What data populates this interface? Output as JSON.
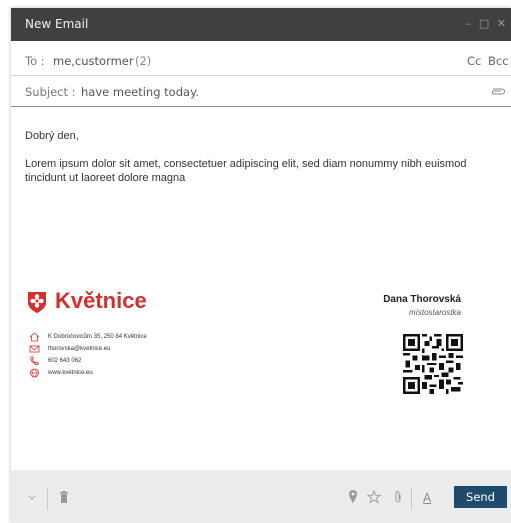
{
  "window": {
    "title": "New Email"
  },
  "to": {
    "label": "To :",
    "value": "me,custormer",
    "count": "(2)",
    "cc_label": "Cc",
    "bcc_label": "Bcc"
  },
  "subject": {
    "label": "Subject :",
    "value": "have meeting today."
  },
  "body": {
    "greeting": "Dobrý den,",
    "paragraph": "Lorem ipsum dolor sit amet, consectetuer adipiscing elit, sed diam nonummy nibh euismod tincidunt ut laoreet dolore magna"
  },
  "signature": {
    "brand": "Květnice",
    "brand_color": "#d32f2f",
    "address": "K Dobročovicům 35, 250 84 Květnice",
    "email": "thorovska@kvetnice.eu",
    "phone": "602 643 062",
    "web": "www.kvetnice.eu",
    "name": "Dana Thorovská",
    "role": "místostarostka"
  },
  "toolbar": {
    "send_label": "Send",
    "send_color": "#1e4a6b",
    "font_label": "A"
  },
  "icons": [
    "minimize-icon",
    "maximize-icon",
    "close-icon",
    "paperclip-icon",
    "chevron-down-icon",
    "trash-icon",
    "location-pin-icon",
    "star-icon",
    "attach-icon",
    "home-icon",
    "mail-icon",
    "phone-icon",
    "globe-icon",
    "qr-code-icon"
  ]
}
